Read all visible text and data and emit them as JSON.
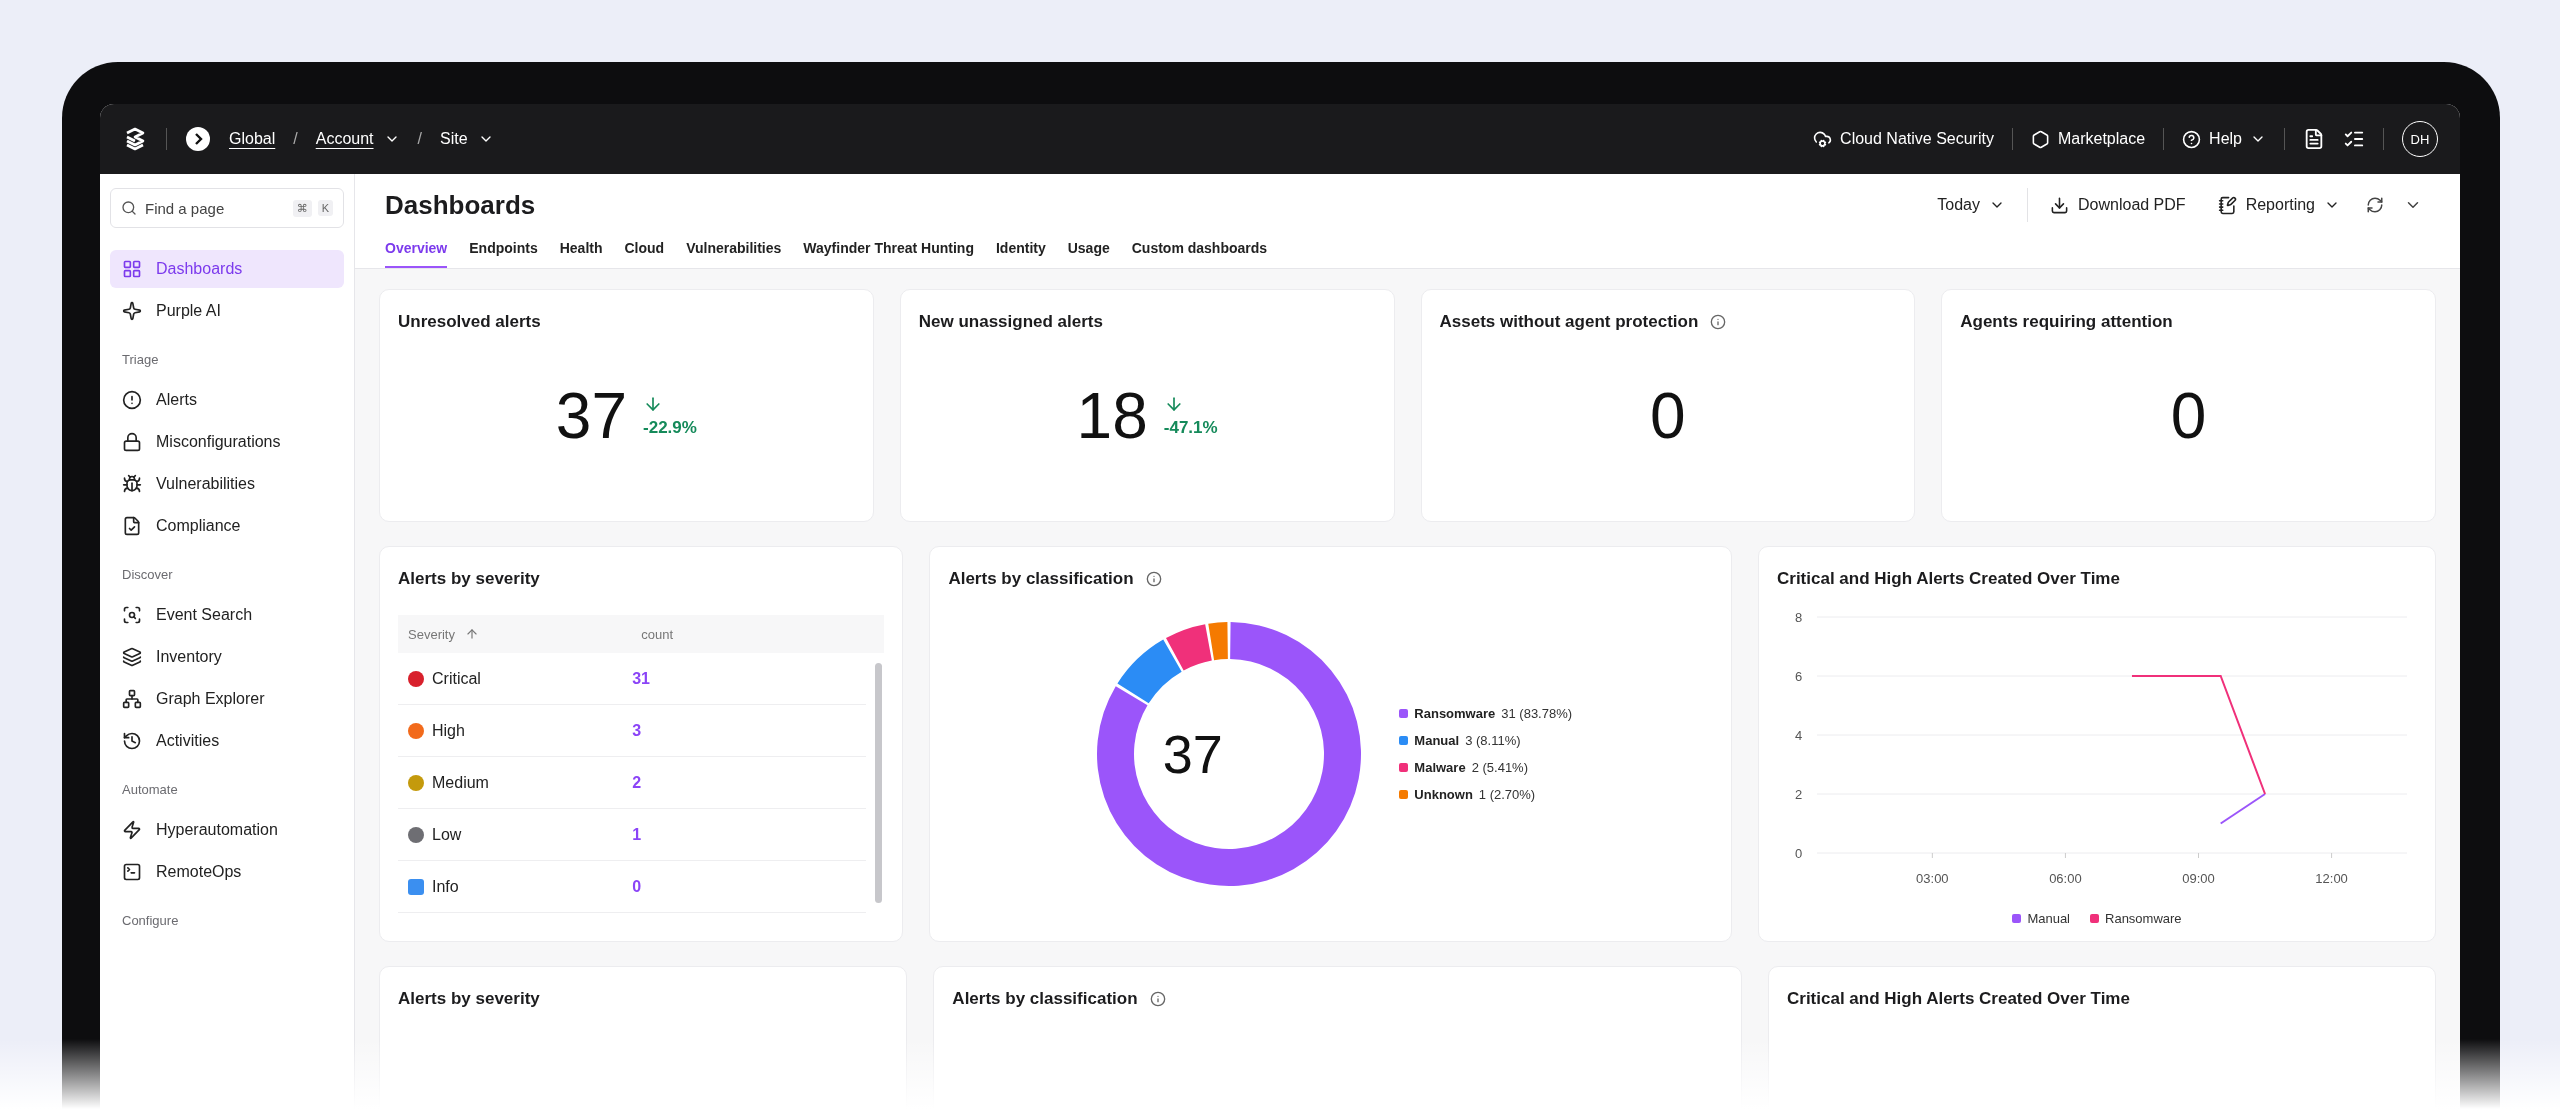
{
  "topbar": {
    "breadcrumbs": [
      {
        "label": "Global",
        "dropdown": false
      },
      {
        "label": "Account",
        "dropdown": true
      },
      {
        "label": "Site",
        "dropdown": true
      }
    ],
    "links": [
      {
        "label": "Cloud Native Security",
        "kind": "cloud",
        "dropdown": false
      },
      {
        "label": "Marketplace",
        "kind": "market",
        "dropdown": false
      },
      {
        "label": "Help",
        "kind": "help",
        "dropdown": true
      }
    ],
    "separator": "/",
    "avatar": "DH"
  },
  "sidebar": {
    "search": {
      "placeholder": "Find a page",
      "shortcut": [
        "⌘",
        "K"
      ]
    },
    "sections": [
      {
        "items": [
          {
            "label": "Dashboards",
            "selected": true
          },
          {
            "label": "Purple AI",
            "selected": false
          }
        ]
      },
      {
        "heading": "Triage",
        "items": [
          {
            "label": "Alerts",
            "selected": false
          },
          {
            "label": "Misconfigurations",
            "selected": false
          },
          {
            "label": "Vulnerabilities",
            "selected": false
          },
          {
            "label": "Compliance",
            "selected": false
          }
        ]
      },
      {
        "heading": "Discover",
        "items": [
          {
            "label": "Event Search",
            "selected": false
          },
          {
            "label": "Inventory",
            "selected": false
          },
          {
            "label": "Graph Explorer",
            "selected": false
          },
          {
            "label": "Activities",
            "selected": false
          }
        ]
      },
      {
        "heading": "Automate",
        "items": [
          {
            "label": "Hyperautomation",
            "selected": false
          },
          {
            "label": "RemoteOps",
            "selected": false
          }
        ]
      },
      {
        "heading": "Configure"
      }
    ]
  },
  "header": {
    "title": "Dashboards",
    "tabs": [
      {
        "label": "Overview",
        "selected": true
      },
      {
        "label": "Endpoints",
        "selected": false
      },
      {
        "label": "Health",
        "selected": false
      },
      {
        "label": "Cloud",
        "selected": false
      },
      {
        "label": "Vulnerabilities",
        "selected": false
      },
      {
        "label": "Wayfinder Threat Hunting",
        "selected": false
      },
      {
        "label": "Identity",
        "selected": false
      },
      {
        "label": "Usage",
        "selected": false
      },
      {
        "label": "Custom dashboards",
        "selected": false
      }
    ],
    "actions": [
      {
        "label": "Today",
        "kind": "range"
      },
      {
        "label": "Download PDF",
        "kind": "download"
      },
      {
        "label": "Reporting",
        "kind": "report"
      }
    ]
  },
  "metrics": [
    {
      "title": "Unresolved alerts",
      "info": false,
      "value": "37",
      "trend": "-22.9%"
    },
    {
      "title": "New unassigned alerts",
      "info": false,
      "value": "18",
      "trend": "-47.1%"
    },
    {
      "title": "Assets without agent protection",
      "info": true,
      "value": "0"
    },
    {
      "title": "Agents requiring attention",
      "info": false,
      "value": "0"
    }
  ],
  "severity_card": {
    "title": "Alerts by severity",
    "columns": [
      "Severity",
      "count"
    ],
    "rows": [
      {
        "name": "Critical",
        "count": "31",
        "color": "#d8202c"
      },
      {
        "name": "High",
        "count": "3",
        "color": "#f26a1b"
      },
      {
        "name": "Medium",
        "count": "2",
        "color": "#c49a0c"
      },
      {
        "name": "Low",
        "count": "1",
        "color": "#6e6e73"
      },
      {
        "name": "Info",
        "count": "0",
        "color": "#3b8ff0"
      }
    ]
  },
  "classification_card": {
    "title": "Alerts by classification",
    "info": true,
    "total": "37",
    "legend": [
      {
        "value": "31 (83.78%)",
        "color": "#9b55fa"
      },
      {
        "value": "3 (8.11%)",
        "color": "#2b8cf5"
      },
      {
        "value": "2 (5.41%)",
        "color": "#f0307a"
      },
      {
        "value": "1 (2.70%)",
        "color": "#f57a00"
      }
    ],
    "chart_data": {
      "type": "donut",
      "categories": [
        "Ransomware",
        "Manual",
        "Malware",
        "Unknown"
      ],
      "values": [
        83.78,
        8.11,
        5.41,
        2.7
      ]
    }
  },
  "timeline_card": {
    "title": "Critical and High Alerts Created Over Time",
    "chart_data": {
      "type": "line",
      "grid": true,
      "x": [
        7.5,
        9.5,
        10.5
      ],
      "xlim": [
        0.4,
        13.7
      ],
      "ylim": [
        0,
        8
      ],
      "yticks": [
        0,
        2,
        4,
        6,
        8
      ],
      "xticks": [
        {
          "value": 3,
          "label": "03:00"
        },
        {
          "value": 6,
          "label": "06:00"
        },
        {
          "value": 9,
          "label": "09:00"
        },
        {
          "value": 12,
          "label": "12:00"
        }
      ],
      "series": [
        {
          "name": "Manual",
          "color": "#9b55fa",
          "values": [
            null,
            1,
            2
          ]
        },
        {
          "name": "Ransomware",
          "color": "#f0307a",
          "values": [
            6,
            6,
            2
          ]
        }
      ]
    }
  },
  "lower_cards": [
    {
      "title": "Alerts by severity",
      "info": false
    },
    {
      "title": "Alerts by classification",
      "info": true
    },
    {
      "title": "Critical and High Alerts Created Over Time",
      "info": false
    }
  ]
}
